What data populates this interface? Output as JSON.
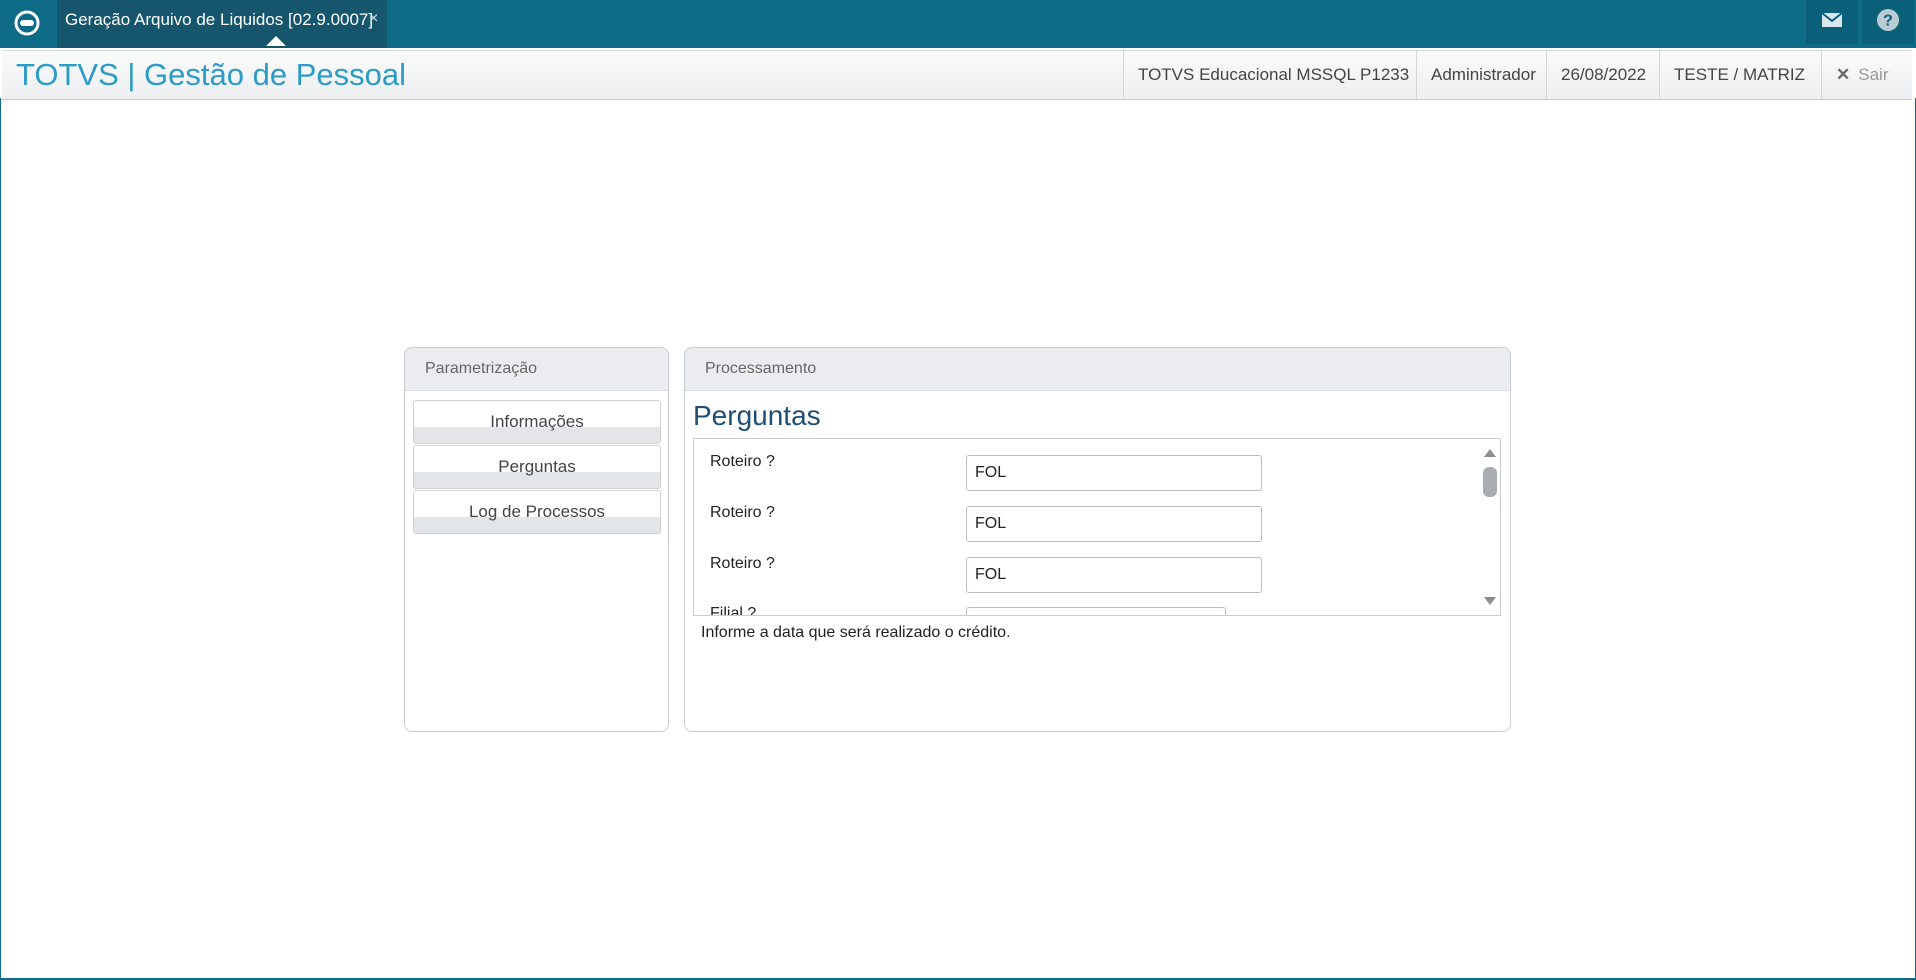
{
  "tab": {
    "title": "Geração Arquivo de Liquidos [02.9.0007]",
    "close": "×"
  },
  "icons": {
    "logo": "totvs-logo-icon",
    "mail": "mail-icon",
    "help": "help-icon",
    "exit": "close-icon"
  },
  "header": {
    "app_title": "TOTVS | Gestão de Pessoal",
    "environment": "TOTVS Educacional MSSQL P1233",
    "user": "Administrador",
    "date": "26/08/2022",
    "company": "TESTE / MATRIZ",
    "exit_label": "Sair"
  },
  "sidebar": {
    "title": "Parametrização",
    "items": [
      {
        "label": "Informações"
      },
      {
        "label": "Perguntas"
      },
      {
        "label": "Log de Processos"
      }
    ]
  },
  "main": {
    "title": "Processamento",
    "heading": "Perguntas",
    "questions": [
      {
        "label": "Roteiro ?",
        "value": "FOL"
      },
      {
        "label": "Roteiro ?",
        "value": "FOL"
      },
      {
        "label": "Roteiro ?",
        "value": "FOL"
      },
      {
        "label": "Filial ?",
        "value": ""
      }
    ],
    "help_text": "Informe a data que será realizado o crédito."
  },
  "colors": {
    "topbar": "#0d6b87",
    "title": "#2c9bc5",
    "heading": "#1f4e74"
  }
}
